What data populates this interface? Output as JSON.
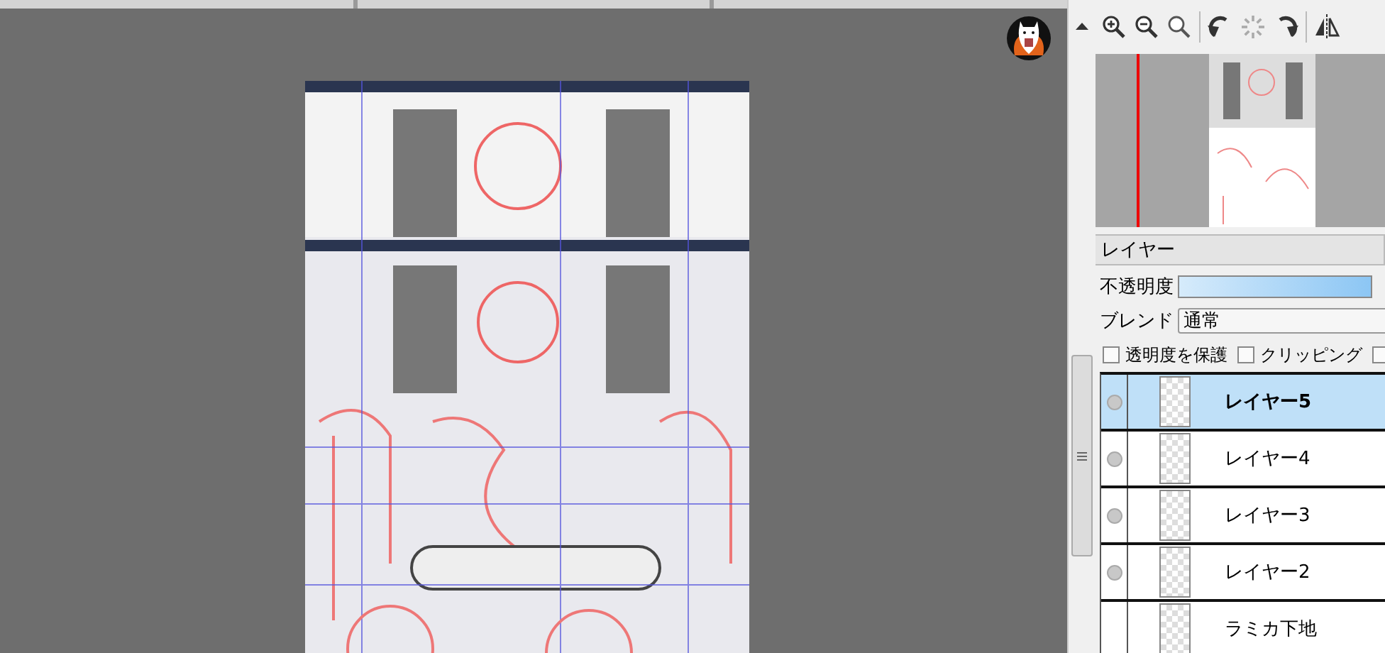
{
  "document_tabs": [
    {
      "selected": false
    },
    {
      "selected": false
    },
    {
      "selected": false
    }
  ],
  "view_tools": [
    {
      "kind": "zoom-in"
    },
    {
      "kind": "zoom-out"
    },
    {
      "kind": "zoom-reset"
    },
    {
      "kind": "rotate-left"
    },
    {
      "kind": "rotate-reset"
    },
    {
      "kind": "rotate-right"
    },
    {
      "kind": "flip"
    }
  ],
  "layer_panel": {
    "title": "レイヤー",
    "opacity": {
      "label": "不透明度",
      "level": 1
    },
    "blend": {
      "label": "ブレンド",
      "value": "通常"
    },
    "options": [
      {
        "label": "透明度を保護",
        "checked": false
      },
      {
        "label": "クリッピング",
        "checked": false
      },
      {
        "checked": false
      }
    ],
    "layers": [
      {
        "name": "レイヤー5",
        "selected": true,
        "visible": true
      },
      {
        "name": "レイヤー4",
        "selected": false,
        "visible": true
      },
      {
        "name": "レイヤー3",
        "selected": false,
        "visible": true
      },
      {
        "name": "レイヤー2",
        "selected": false,
        "visible": true
      },
      {
        "name": "ラミカ下地",
        "selected": false,
        "visible": false
      }
    ]
  }
}
